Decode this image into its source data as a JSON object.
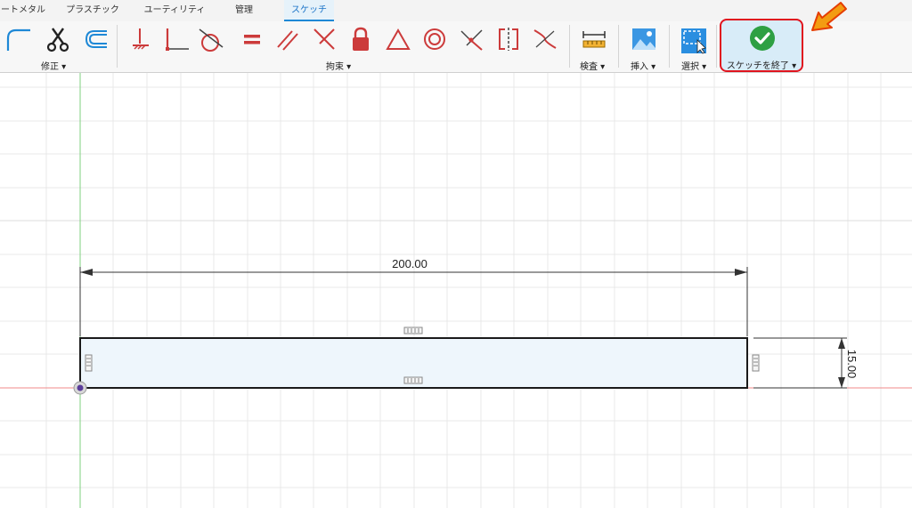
{
  "tabs": [
    {
      "label": "ートメタル"
    },
    {
      "label": "プラスチック"
    },
    {
      "label": "ユーティリティ"
    },
    {
      "label": "管理"
    },
    {
      "label": "スケッチ"
    }
  ],
  "active_tab_index": 4,
  "ribbon": {
    "modify_label": "修正 ▾",
    "constraints_label": "拘束 ▾",
    "inspect_label": "検査 ▾",
    "insert_label": "挿入 ▾",
    "select_label": "選択 ▾",
    "finish_label": "スケッチを終了 ▾"
  },
  "sketch": {
    "width_dimension": "200.00",
    "height_dimension": "15.00"
  },
  "colors": {
    "accent": "#1e88d6",
    "highlight": "#e0141e",
    "constraint_icon": "#cc3b3b",
    "finish_check": "#2ea043",
    "x_axis": "#f08a8a",
    "y_axis": "#7fd07f",
    "profile_fill": "#eef6fc"
  }
}
